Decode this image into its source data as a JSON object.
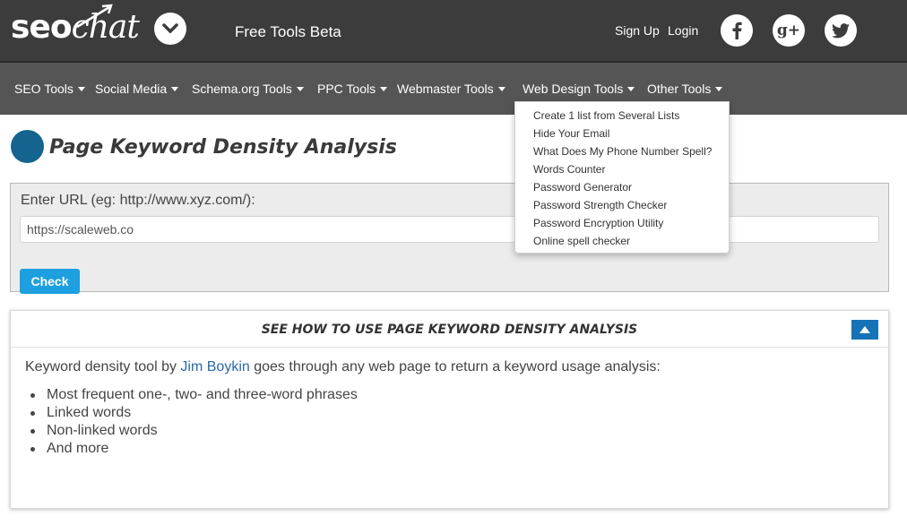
{
  "header": {
    "logo_seo": "seo",
    "logo_chat": "chat",
    "subtitle": "Free Tools Beta",
    "signup_label": "Sign Up",
    "login_label": "Login",
    "social_icons": [
      "facebook-icon",
      "google-plus-icon",
      "twitter-icon"
    ],
    "google_plus_glyph": "g+"
  },
  "nav": {
    "items": [
      {
        "label": "SEO Tools"
      },
      {
        "label": "Social Media"
      },
      {
        "label": "Schema.org Tools"
      },
      {
        "label": "PPC Tools"
      },
      {
        "label": "Webmaster Tools"
      },
      {
        "label": "Web Design Tools"
      },
      {
        "label": "Other Tools"
      }
    ]
  },
  "dropdown": {
    "items": [
      "Create 1 list from Several Lists",
      "Hide Your Email",
      "What Does My Phone Number Spell?",
      "Words Counter",
      "Password Generator",
      "Password Strength Checker",
      "Password Encryption Utility",
      "Online spell checker"
    ]
  },
  "page": {
    "title": "Page Keyword Density Analysis",
    "title_circle_color": "#14648f"
  },
  "form": {
    "url_label": "Enter URL (eg: http://www.xyz.com/):",
    "url_value": "https://scaleweb.co",
    "check_label": "Check",
    "check_color": "#1e9fdf"
  },
  "info": {
    "header": "SEE HOW TO USE PAGE KEYWORD DENSITY ANALYSIS",
    "intro_before": "Keyword density tool by ",
    "intro_link": "Jim Boykin",
    "intro_after": " goes through any web page to return a keyword usage analysis:",
    "list": [
      "Most frequent one-, two- and three-word phrases",
      "Linked words",
      "Non-linked words",
      "And more"
    ]
  },
  "colors": {
    "header_bg": "#3c3c3c",
    "nav_bg": "#555555",
    "collapse_button": "#1673b8",
    "link": "#2a6aa8"
  }
}
